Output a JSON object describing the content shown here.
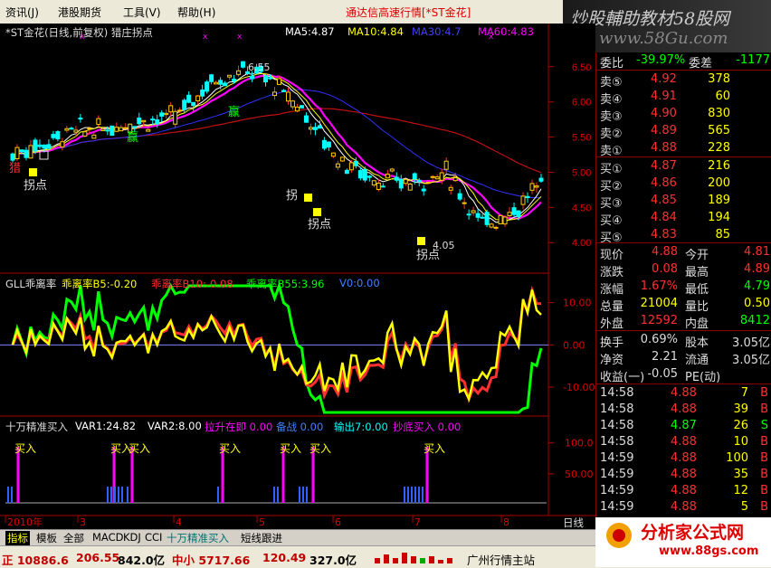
{
  "menu": {
    "items": [
      "资讯(J)",
      "港股期货",
      "工具(V)",
      "帮助(H)"
    ],
    "title": "通达信高速行情[*ST金花]"
  },
  "watermark": {
    "line1": "炒股輔助教材58股网",
    "line2": "www.58Gu.com"
  },
  "main_chart": {
    "title": "*ST金花(日线,前复权) 猎庄拐点",
    "ma": [
      {
        "label": "MA5:4.87",
        "color": "#ffffff"
      },
      {
        "label": "MA10:4.84",
        "color": "#ffff00"
      },
      {
        "label": "MA30:4.7",
        "color": "#4040ff"
      },
      {
        "label": "MA60:4.83",
        "color": "#ff00ff"
      }
    ],
    "price_ticks": [
      "6.50",
      "6.00",
      "5.50",
      "5.00",
      "4.50",
      "4.00"
    ],
    "high_label": "6.55",
    "low_label": "4.05",
    "annotations": [
      "猎",
      "拐点",
      "赢",
      "赢",
      "拐",
      "拐点",
      "拐点"
    ]
  },
  "indicator1": {
    "title": "GLL乖离率",
    "labels": [
      "乖离率B5:-0.20",
      "乖离率B10:-0.08",
      "乖离率B55:3.96",
      "V0:0.00"
    ],
    "label_colors": [
      "#ffff00",
      "#ff3030",
      "#00ff00",
      "#4080ff"
    ],
    "ticks": [
      "10.00",
      "0.00",
      "-10.00"
    ]
  },
  "indicator2": {
    "title": "十万精准买入",
    "labels": [
      "VAR1:24.82",
      "VAR2:8.00",
      "拉升在即 0.00",
      "备战 0.00",
      "输出7:0.00",
      "抄底买入 0.00"
    ],
    "label_colors": [
      "#ffffff",
      "#ffffff",
      "#ff00ff",
      "#4080ff",
      "#00ffff",
      "#ff00ff"
    ],
    "ticks": [
      "100.0",
      "50.00"
    ],
    "buy_label": "买入"
  },
  "x_axis": {
    "labels": [
      "2010年",
      "3",
      "4",
      "5",
      "6",
      "7",
      "8"
    ],
    "period": "日线"
  },
  "quotes": {
    "weibi_label": "委比",
    "weibi": "-39.97%",
    "weicha_label": "委差",
    "weicha": "-1177",
    "sell": [
      {
        "label": "卖⑤",
        "price": "4.92",
        "vol": "378"
      },
      {
        "label": "卖④",
        "price": "4.91",
        "vol": "60"
      },
      {
        "label": "卖③",
        "price": "4.90",
        "vol": "830"
      },
      {
        "label": "卖②",
        "price": "4.89",
        "vol": "565"
      },
      {
        "label": "卖①",
        "price": "4.88",
        "vol": "228"
      }
    ],
    "buy": [
      {
        "label": "买①",
        "price": "4.87",
        "vol": "216"
      },
      {
        "label": "买②",
        "price": "4.86",
        "vol": "200"
      },
      {
        "label": "买③",
        "price": "4.85",
        "vol": "189"
      },
      {
        "label": "买④",
        "price": "4.84",
        "vol": "194"
      },
      {
        "label": "买⑤",
        "price": "4.83",
        "vol": "85"
      }
    ],
    "stats": [
      {
        "l1": "现价",
        "v1": "4.88",
        "c1": "#ff3030",
        "l2": "今开",
        "v2": "4.81",
        "c2": "#ff3030"
      },
      {
        "l1": "涨跌",
        "v1": "0.08",
        "c1": "#ff3030",
        "l2": "最高",
        "v2": "4.89",
        "c2": "#ff3030"
      },
      {
        "l1": "涨幅",
        "v1": "1.67%",
        "c1": "#ff3030",
        "l2": "最低",
        "v2": "4.79",
        "c2": "#00ff00"
      },
      {
        "l1": "总量",
        "v1": "21004",
        "c1": "#ffff00",
        "l2": "量比",
        "v2": "0.50",
        "c2": "#ffff00"
      },
      {
        "l1": "外盘",
        "v1": "12592",
        "c1": "#ff3030",
        "l2": "内盘",
        "v2": "8412",
        "c2": "#00ff00"
      }
    ],
    "stats2": [
      {
        "l1": "换手",
        "v1": "0.69%",
        "l2": "股本",
        "v2": "3.05亿"
      },
      {
        "l1": "净资",
        "v1": "2.21",
        "l2": "流通",
        "v2": "3.05亿"
      },
      {
        "l1": "收益(一)",
        "v1": "-0.05",
        "l2": "PE(动)",
        "v2": ""
      }
    ],
    "ticks": [
      {
        "time": "14:58",
        "price": "4.88",
        "vol": "7",
        "bs": "B",
        "c": "#ff3030"
      },
      {
        "time": "14:58",
        "price": "4.88",
        "vol": "39",
        "bs": "B",
        "c": "#ff3030"
      },
      {
        "time": "14:58",
        "price": "4.87",
        "vol": "26",
        "bs": "S",
        "c": "#00ff00"
      },
      {
        "time": "14:58",
        "price": "4.88",
        "vol": "10",
        "bs": "B",
        "c": "#ff3030"
      },
      {
        "time": "14:59",
        "price": "4.88",
        "vol": "100",
        "bs": "B",
        "c": "#ff3030"
      },
      {
        "time": "14:59",
        "price": "4.88",
        "vol": "35",
        "bs": "B",
        "c": "#ff3030"
      },
      {
        "time": "14:59",
        "price": "4.88",
        "vol": "12",
        "bs": "B",
        "c": "#ff3030"
      },
      {
        "time": "14:59",
        "price": "4.88",
        "vol": "5",
        "bs": "B",
        "c": "#ff3030"
      }
    ]
  },
  "tabs": [
    "指标",
    "模板",
    "全部",
    "MACD",
    "KDJ",
    "CCI",
    "十万精准买入",
    "短线跟进"
  ],
  "status": [
    {
      "text": "正 10886.6",
      "c": "#c00000"
    },
    {
      "text": "206.55",
      "c": "#c00000"
    },
    {
      "text": "842.0亿",
      "c": "#000000"
    },
    {
      "text": "中小 5717.66",
      "c": "#c00000"
    },
    {
      "text": "120.49",
      "c": "#c00000"
    },
    {
      "text": "327.0亿",
      "c": "#000000"
    },
    {
      "text": "广州行情主站",
      "c": "#000000"
    }
  ],
  "logo": {
    "name": "分析家公式网",
    "url": "www.88gs.com"
  }
}
